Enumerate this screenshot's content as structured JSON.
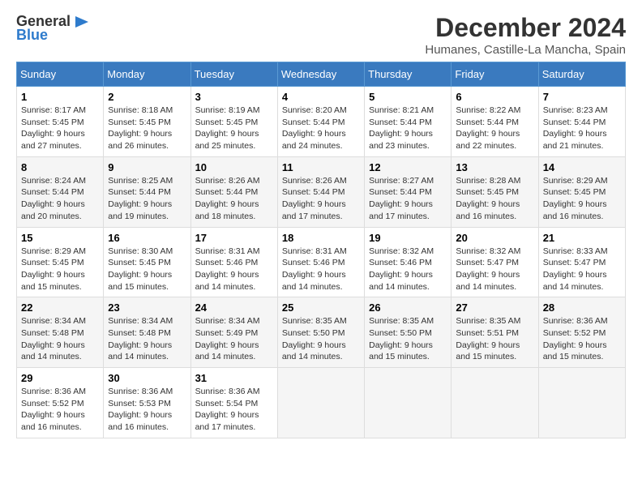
{
  "logo": {
    "general": "General",
    "blue": "Blue",
    "icon": "▶"
  },
  "title": "December 2024",
  "subtitle": "Humanes, Castille-La Mancha, Spain",
  "days_header": [
    "Sunday",
    "Monday",
    "Tuesday",
    "Wednesday",
    "Thursday",
    "Friday",
    "Saturday"
  ],
  "weeks": [
    [
      {
        "day": "1",
        "sunrise": "Sunrise: 8:17 AM",
        "sunset": "Sunset: 5:45 PM",
        "daylight": "Daylight: 9 hours and 27 minutes."
      },
      {
        "day": "2",
        "sunrise": "Sunrise: 8:18 AM",
        "sunset": "Sunset: 5:45 PM",
        "daylight": "Daylight: 9 hours and 26 minutes."
      },
      {
        "day": "3",
        "sunrise": "Sunrise: 8:19 AM",
        "sunset": "Sunset: 5:45 PM",
        "daylight": "Daylight: 9 hours and 25 minutes."
      },
      {
        "day": "4",
        "sunrise": "Sunrise: 8:20 AM",
        "sunset": "Sunset: 5:44 PM",
        "daylight": "Daylight: 9 hours and 24 minutes."
      },
      {
        "day": "5",
        "sunrise": "Sunrise: 8:21 AM",
        "sunset": "Sunset: 5:44 PM",
        "daylight": "Daylight: 9 hours and 23 minutes."
      },
      {
        "day": "6",
        "sunrise": "Sunrise: 8:22 AM",
        "sunset": "Sunset: 5:44 PM",
        "daylight": "Daylight: 9 hours and 22 minutes."
      },
      {
        "day": "7",
        "sunrise": "Sunrise: 8:23 AM",
        "sunset": "Sunset: 5:44 PM",
        "daylight": "Daylight: 9 hours and 21 minutes."
      }
    ],
    [
      {
        "day": "8",
        "sunrise": "Sunrise: 8:24 AM",
        "sunset": "Sunset: 5:44 PM",
        "daylight": "Daylight: 9 hours and 20 minutes."
      },
      {
        "day": "9",
        "sunrise": "Sunrise: 8:25 AM",
        "sunset": "Sunset: 5:44 PM",
        "daylight": "Daylight: 9 hours and 19 minutes."
      },
      {
        "day": "10",
        "sunrise": "Sunrise: 8:26 AM",
        "sunset": "Sunset: 5:44 PM",
        "daylight": "Daylight: 9 hours and 18 minutes."
      },
      {
        "day": "11",
        "sunrise": "Sunrise: 8:26 AM",
        "sunset": "Sunset: 5:44 PM",
        "daylight": "Daylight: 9 hours and 17 minutes."
      },
      {
        "day": "12",
        "sunrise": "Sunrise: 8:27 AM",
        "sunset": "Sunset: 5:44 PM",
        "daylight": "Daylight: 9 hours and 17 minutes."
      },
      {
        "day": "13",
        "sunrise": "Sunrise: 8:28 AM",
        "sunset": "Sunset: 5:45 PM",
        "daylight": "Daylight: 9 hours and 16 minutes."
      },
      {
        "day": "14",
        "sunrise": "Sunrise: 8:29 AM",
        "sunset": "Sunset: 5:45 PM",
        "daylight": "Daylight: 9 hours and 16 minutes."
      }
    ],
    [
      {
        "day": "15",
        "sunrise": "Sunrise: 8:29 AM",
        "sunset": "Sunset: 5:45 PM",
        "daylight": "Daylight: 9 hours and 15 minutes."
      },
      {
        "day": "16",
        "sunrise": "Sunrise: 8:30 AM",
        "sunset": "Sunset: 5:45 PM",
        "daylight": "Daylight: 9 hours and 15 minutes."
      },
      {
        "day": "17",
        "sunrise": "Sunrise: 8:31 AM",
        "sunset": "Sunset: 5:46 PM",
        "daylight": "Daylight: 9 hours and 14 minutes."
      },
      {
        "day": "18",
        "sunrise": "Sunrise: 8:31 AM",
        "sunset": "Sunset: 5:46 PM",
        "daylight": "Daylight: 9 hours and 14 minutes."
      },
      {
        "day": "19",
        "sunrise": "Sunrise: 8:32 AM",
        "sunset": "Sunset: 5:46 PM",
        "daylight": "Daylight: 9 hours and 14 minutes."
      },
      {
        "day": "20",
        "sunrise": "Sunrise: 8:32 AM",
        "sunset": "Sunset: 5:47 PM",
        "daylight": "Daylight: 9 hours and 14 minutes."
      },
      {
        "day": "21",
        "sunrise": "Sunrise: 8:33 AM",
        "sunset": "Sunset: 5:47 PM",
        "daylight": "Daylight: 9 hours and 14 minutes."
      }
    ],
    [
      {
        "day": "22",
        "sunrise": "Sunrise: 8:34 AM",
        "sunset": "Sunset: 5:48 PM",
        "daylight": "Daylight: 9 hours and 14 minutes."
      },
      {
        "day": "23",
        "sunrise": "Sunrise: 8:34 AM",
        "sunset": "Sunset: 5:48 PM",
        "daylight": "Daylight: 9 hours and 14 minutes."
      },
      {
        "day": "24",
        "sunrise": "Sunrise: 8:34 AM",
        "sunset": "Sunset: 5:49 PM",
        "daylight": "Daylight: 9 hours and 14 minutes."
      },
      {
        "day": "25",
        "sunrise": "Sunrise: 8:35 AM",
        "sunset": "Sunset: 5:50 PM",
        "daylight": "Daylight: 9 hours and 14 minutes."
      },
      {
        "day": "26",
        "sunrise": "Sunrise: 8:35 AM",
        "sunset": "Sunset: 5:50 PM",
        "daylight": "Daylight: 9 hours and 15 minutes."
      },
      {
        "day": "27",
        "sunrise": "Sunrise: 8:35 AM",
        "sunset": "Sunset: 5:51 PM",
        "daylight": "Daylight: 9 hours and 15 minutes."
      },
      {
        "day": "28",
        "sunrise": "Sunrise: 8:36 AM",
        "sunset": "Sunset: 5:52 PM",
        "daylight": "Daylight: 9 hours and 15 minutes."
      }
    ],
    [
      {
        "day": "29",
        "sunrise": "Sunrise: 8:36 AM",
        "sunset": "Sunset: 5:52 PM",
        "daylight": "Daylight: 9 hours and 16 minutes."
      },
      {
        "day": "30",
        "sunrise": "Sunrise: 8:36 AM",
        "sunset": "Sunset: 5:53 PM",
        "daylight": "Daylight: 9 hours and 16 minutes."
      },
      {
        "day": "31",
        "sunrise": "Sunrise: 8:36 AM",
        "sunset": "Sunset: 5:54 PM",
        "daylight": "Daylight: 9 hours and 17 minutes."
      },
      null,
      null,
      null,
      null
    ]
  ]
}
